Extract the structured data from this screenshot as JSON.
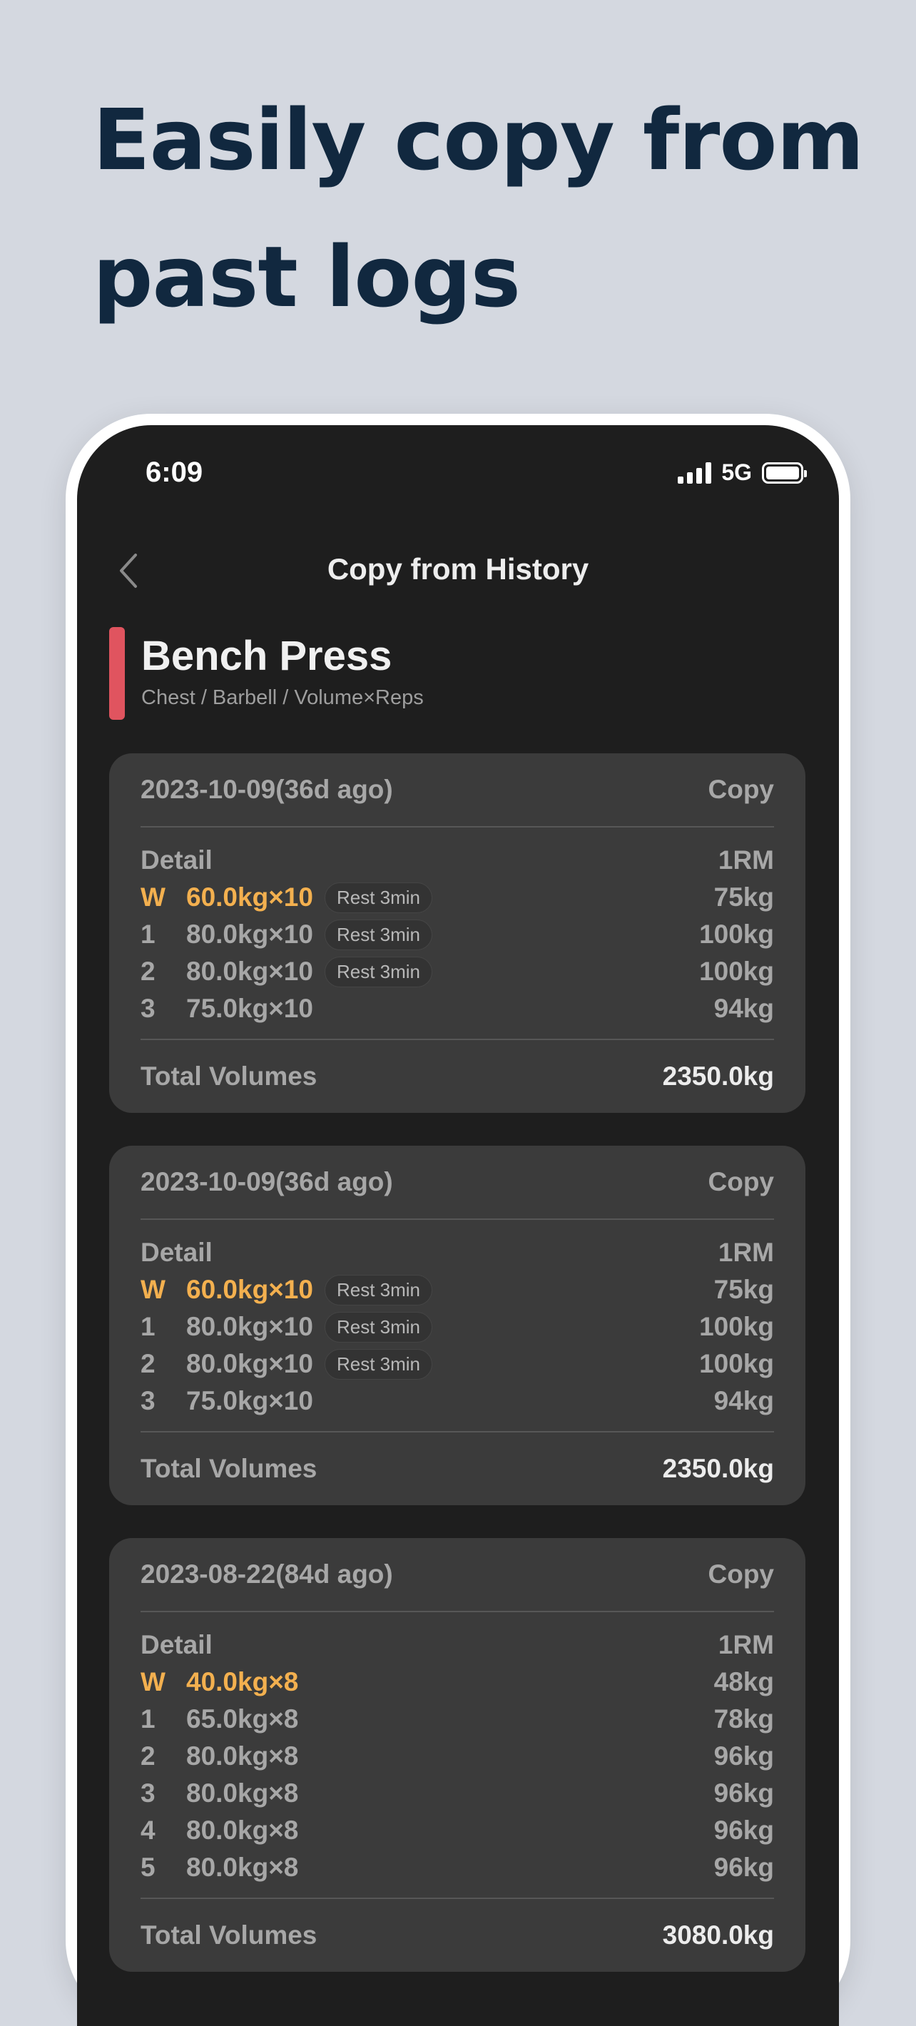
{
  "headline": {
    "line1": "Easily copy from",
    "line2": "past logs"
  },
  "status_bar": {
    "time": "6:09",
    "network": "5G",
    "icons": [
      "signal-bars-icon",
      "battery-icon"
    ]
  },
  "nav": {
    "back_icon": "chevron-left-icon",
    "title": "Copy from History"
  },
  "exercise": {
    "name": "Bench Press",
    "subtitle": "Chest / Barbell / Volume×Reps",
    "accent_color": "#e0545f"
  },
  "labels": {
    "detail": "Detail",
    "one_rm": "1RM",
    "total": "Total Volumes",
    "copy": "Copy"
  },
  "colors": {
    "warmup": "#f3b04f",
    "card_bg": "#3b3b3b",
    "screen_bg": "#1e1e1e"
  },
  "history": [
    {
      "date": "2023-10-09(36d ago)",
      "sets": [
        {
          "label": "W",
          "weight": "60.0kg×10",
          "rest": "Rest 3min",
          "one_rm": "75kg",
          "warmup": true
        },
        {
          "label": "1",
          "weight": "80.0kg×10",
          "rest": "Rest 3min",
          "one_rm": "100kg",
          "warmup": false
        },
        {
          "label": "2",
          "weight": "80.0kg×10",
          "rest": "Rest 3min",
          "one_rm": "100kg",
          "warmup": false
        },
        {
          "label": "3",
          "weight": "75.0kg×10",
          "rest": "",
          "one_rm": "94kg",
          "warmup": false
        }
      ],
      "total": "2350.0kg"
    },
    {
      "date": "2023-10-09(36d ago)",
      "sets": [
        {
          "label": "W",
          "weight": "60.0kg×10",
          "rest": "Rest 3min",
          "one_rm": "75kg",
          "warmup": true
        },
        {
          "label": "1",
          "weight": "80.0kg×10",
          "rest": "Rest 3min",
          "one_rm": "100kg",
          "warmup": false
        },
        {
          "label": "2",
          "weight": "80.0kg×10",
          "rest": "Rest 3min",
          "one_rm": "100kg",
          "warmup": false
        },
        {
          "label": "3",
          "weight": "75.0kg×10",
          "rest": "",
          "one_rm": "94kg",
          "warmup": false
        }
      ],
      "total": "2350.0kg"
    },
    {
      "date": "2023-08-22(84d ago)",
      "sets": [
        {
          "label": "W",
          "weight": "40.0kg×8",
          "rest": "",
          "one_rm": "48kg",
          "warmup": true
        },
        {
          "label": "1",
          "weight": "65.0kg×8",
          "rest": "",
          "one_rm": "78kg",
          "warmup": false
        },
        {
          "label": "2",
          "weight": "80.0kg×8",
          "rest": "",
          "one_rm": "96kg",
          "warmup": false
        },
        {
          "label": "3",
          "weight": "80.0kg×8",
          "rest": "",
          "one_rm": "96kg",
          "warmup": false
        },
        {
          "label": "4",
          "weight": "80.0kg×8",
          "rest": "",
          "one_rm": "96kg",
          "warmup": false
        },
        {
          "label": "5",
          "weight": "80.0kg×8",
          "rest": "",
          "one_rm": "96kg",
          "warmup": false
        }
      ],
      "total": "3080.0kg"
    }
  ]
}
